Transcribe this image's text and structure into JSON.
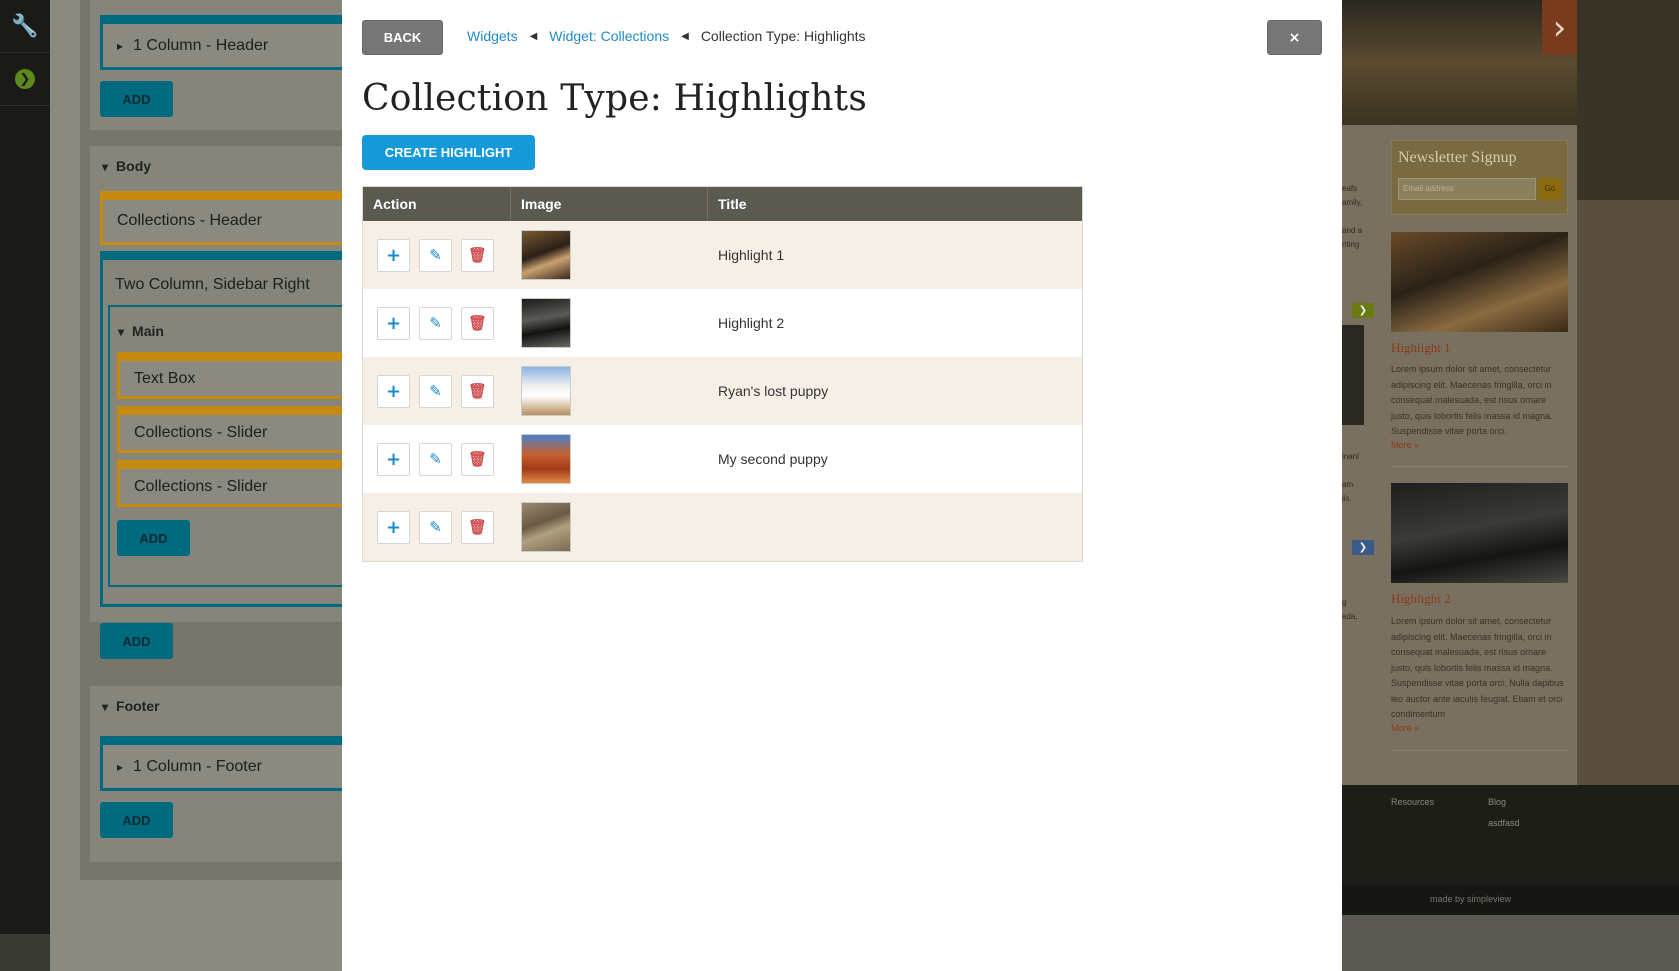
{
  "modal": {
    "back_label": "BACK",
    "close_label": "×",
    "breadcrumbs": [
      "Widgets",
      "Widget: Collections",
      "Collection Type: Highlights"
    ],
    "title": "Collection Type: Highlights",
    "create_label": "CREATE HIGHLIGHT",
    "table": {
      "headers": [
        "Action",
        "Image",
        "Title"
      ],
      "rows": [
        {
          "title": "Highlight 1",
          "thumb": "wine-shop-photo"
        },
        {
          "title": "Highlight 2",
          "thumb": "bar-interior-photo"
        },
        {
          "title": "Ryan's lost puppy",
          "thumb": "white-mission-photo"
        },
        {
          "title": "My second puppy",
          "thumb": "red-rock-photo"
        },
        {
          "title": "",
          "thumb": "hiker-desert-photo"
        }
      ]
    }
  },
  "builder": {
    "header_row": "1 Column - Header",
    "add_label": "ADD",
    "body_title": "Body",
    "collections_header": "Collections - Header",
    "two_column": "Two Column, Sidebar Right",
    "main_title": "Main",
    "text_box": "Text Box",
    "slider_1": "Collections - Slider",
    "slider_2": "Collections - Slider",
    "footer_title": "Footer",
    "footer_row": "1 Column - Footer"
  },
  "preview": {
    "newsletter_title": "Newsletter Signup",
    "email_placeholder": "Email address",
    "go_label": "Go",
    "h1_title": "Highlight 1",
    "h1_body": "Lorem ipsum dolor sit amet, consectetur adipiscing elit. Maecenas fringilla, orci in consequat malesuada, est risus ornare justo, quis lobortis felis massa id magna. Suspendisse vitae porta orci.",
    "h2_title": "Highlight 2",
    "h2_body": "Lorem ipsum dolor sit amet, consectetur adipiscing elit. Maecenas fringilla, orci in consequat malesuada, est risus ornare justo, quis lobortis felis massa id magna. Suspendisse vitae porta orci. Nulla dapibus leo auctor ante iaculis feugiat. Etiam et orci condimentum",
    "more_label": "More »",
    "footer_links": [
      "Resources",
      "Blog",
      "asdfasd"
    ],
    "made_by": "made by simpleview"
  }
}
